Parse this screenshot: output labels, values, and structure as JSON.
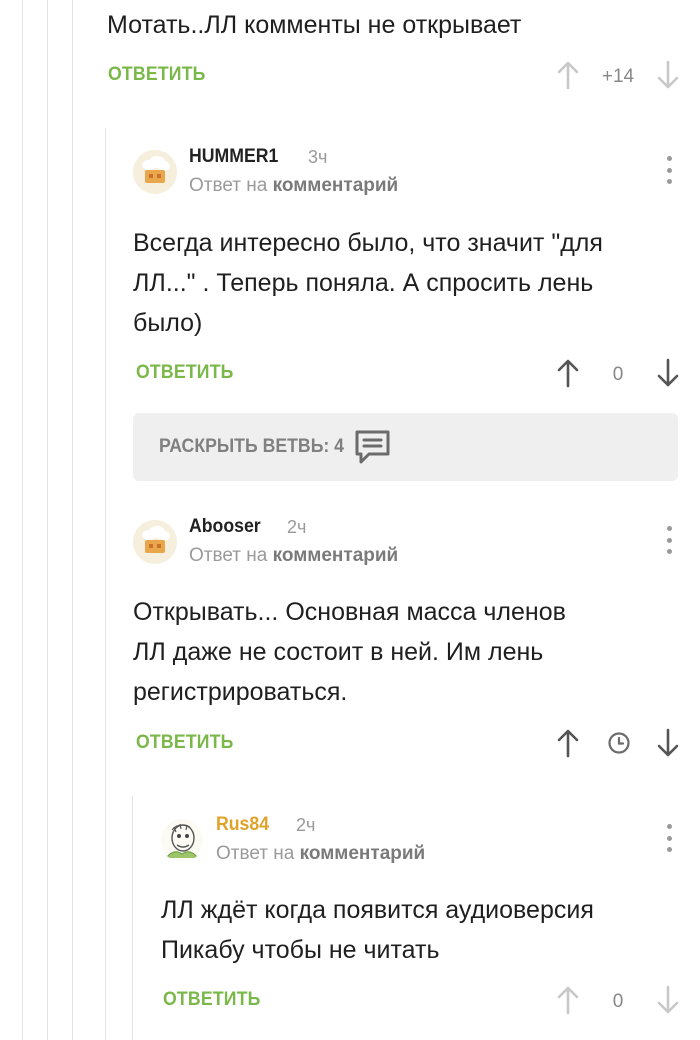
{
  "colors": {
    "reply": "#7ab84a",
    "username_gold": "#e0a329",
    "muted": "#9a9a9a",
    "thread_line": "#e3e3e3",
    "branch_bg": "#efefef"
  },
  "top_comment": {
    "text": "Мотать..ЛЛ комменты не открывает",
    "reply_label": "ОТВЕТИТЬ",
    "rating": "+14",
    "upvote_icon": "arrow-up-icon",
    "downvote_icon": "arrow-down-icon"
  },
  "comments": [
    {
      "username": "HUMMER1",
      "time": "3ч",
      "reply_prefix": "Ответ на",
      "reply_target": "комментарий",
      "text_lines": [
        "Всегда интересно было,  что значит \"для",
        "ЛЛ...\" . Теперь поняла. А спросить лень",
        "было)"
      ],
      "reply_label": "ОТВЕТИТЬ",
      "rating": "0"
    },
    {
      "username": "Abooser",
      "time": "2ч",
      "reply_prefix": "Ответ на",
      "reply_target": "комментарий",
      "text_lines": [
        "Открывать... Основная масса членов",
        "ЛЛ даже не состоит в ней. Им лень",
        "регистрироваться."
      ],
      "reply_label": "ОТВЕТИТЬ",
      "rating_icon": "clock-icon"
    },
    {
      "username": "Rus84",
      "time": "2ч",
      "reply_prefix": "Ответ на",
      "reply_target": "комментарий",
      "text_lines": [
        "ЛЛ ждёт когда появится аудиоверсия",
        "Пикабу чтобы не читать"
      ],
      "reply_label": "ОТВЕТИТЬ",
      "rating": "0"
    }
  ],
  "branch": {
    "label": "РАСКРЫТЬ ВЕТВЬ: 4",
    "icon": "comments-icon"
  }
}
